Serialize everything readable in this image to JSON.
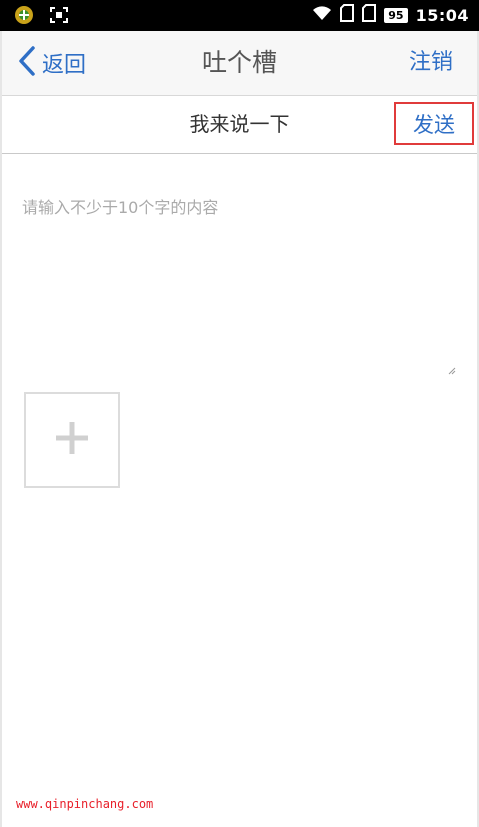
{
  "status_bar": {
    "battery": "95",
    "time": "15:04"
  },
  "nav": {
    "back_label": "返回",
    "title": "吐个槽",
    "logout_label": "注销"
  },
  "compose": {
    "title": "我来说一下",
    "send_label": "发送",
    "content_placeholder": "请输入不少于10个字的内容",
    "content_value": ""
  },
  "watermark": "www.qinpinchang.com",
  "colors": {
    "accent": "#2f6fc6",
    "highlight": "#e03b3b",
    "watermark": "#e8202a"
  }
}
